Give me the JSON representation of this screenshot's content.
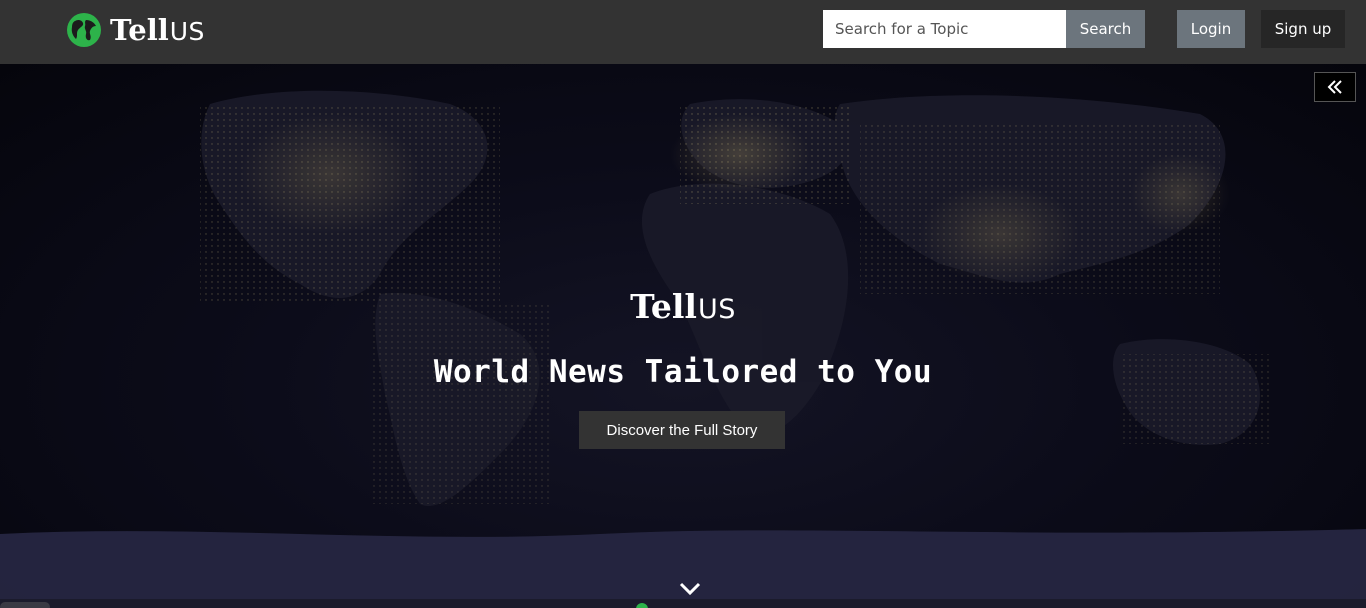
{
  "brand": {
    "name_bold": "Tell",
    "name_light": "US"
  },
  "header": {
    "search": {
      "placeholder": "Search for a Topic",
      "value": "",
      "button_label": "Search"
    },
    "login_label": "Login",
    "signup_label": "Sign up"
  },
  "hero": {
    "logo_bold": "Tell",
    "logo_light": "US",
    "title": "World News Tailored to You",
    "cta_label": "Discover the Full Story"
  },
  "icons": {
    "logo": "globe-icon",
    "collapse": "double-chevron-left-icon",
    "scroll": "chevron-down-icon"
  },
  "colors": {
    "navbar": "#333333",
    "accent_green": "#2db34a",
    "button_gray": "#6c757d",
    "hero_background": "#0c0c1a"
  }
}
